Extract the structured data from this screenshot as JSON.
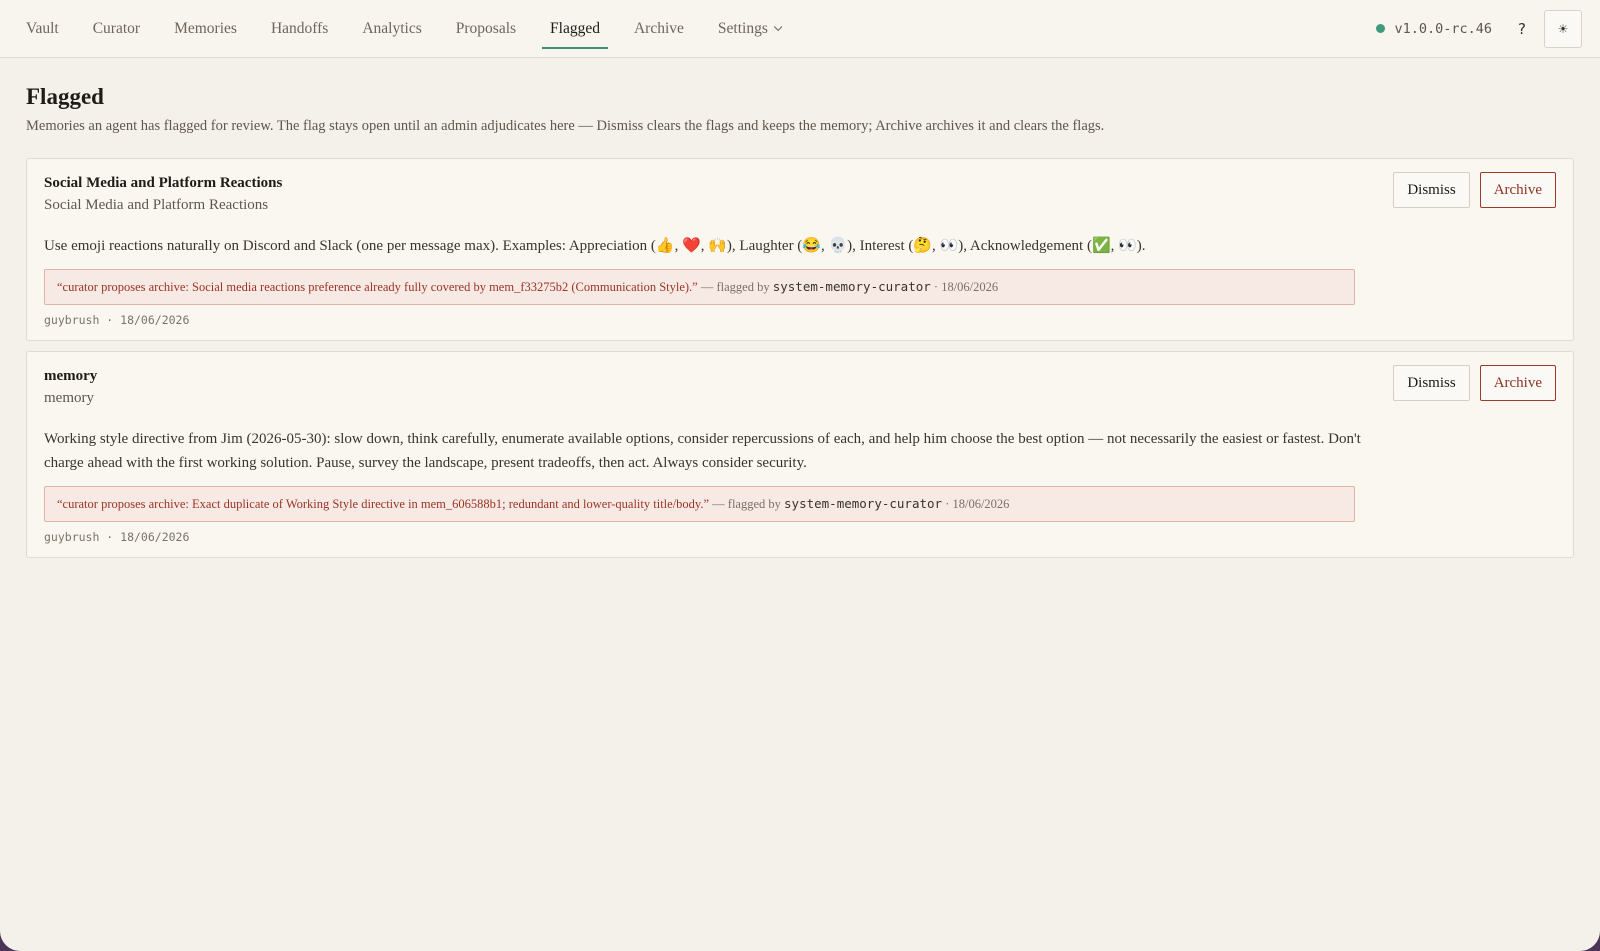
{
  "nav": {
    "tabs": [
      {
        "label": "Vault"
      },
      {
        "label": "Curator"
      },
      {
        "label": "Memories"
      },
      {
        "label": "Handoffs"
      },
      {
        "label": "Analytics"
      },
      {
        "label": "Proposals"
      },
      {
        "label": "Flagged"
      },
      {
        "label": "Archive"
      },
      {
        "label": "Settings"
      }
    ],
    "active_tab": "Flagged",
    "version": "v1.0.0-rc.46",
    "status_color": "#3f9a7e",
    "help_label": "?",
    "theme_icon": "sun-icon",
    "theme_glyph": "☀"
  },
  "page": {
    "title": "Flagged",
    "description": "Memories an agent has flagged for review. The flag stays open until an admin adjudicates here — Dismiss clears the flags and keeps the memory; Archive archives it and clears the flags."
  },
  "actions": {
    "dismiss_label": "Dismiss",
    "archive_label": "Archive"
  },
  "flag_labels": {
    "flagged_by_prefix": "— flagged by",
    "separator": "·"
  },
  "items": [
    {
      "title": "Social Media and Platform Reactions",
      "subtitle": "Social Media and Platform Reactions",
      "body": "Use emoji reactions naturally on Discord and Slack (one per message max). Examples: Appreciation (👍, ❤️, 🙌), Laughter (😂, 💀), Interest (🤔, 👀), Acknowledgement (✅, 👀).",
      "flag_reason": "“curator proposes archive: Social media reactions preference already fully covered by mem_f33275b2 (Communication Style).”",
      "flagged_by": "system-memory-curator",
      "flag_date": "18/06/2026",
      "author": "guybrush",
      "date": "18/06/2026",
      "meta": "guybrush · 18/06/2026"
    },
    {
      "title": "memory",
      "subtitle": "memory",
      "body": "Working style directive from Jim (2026-05-30): slow down, think carefully, enumerate available options, consider repercussions of each, and help him choose the best option — not necessarily the easiest or fastest. Don't charge ahead with the first working solution. Pause, survey the landscape, present tradeoffs, then act. Always consider security.",
      "flag_reason": "“curator proposes archive: Exact duplicate of Working Style directive in mem_606588b1; redundant and lower-quality title/body.”",
      "flagged_by": "system-memory-curator",
      "flag_date": "18/06/2026",
      "author": "guybrush",
      "date": "18/06/2026",
      "meta": "guybrush · 18/06/2026"
    }
  ]
}
